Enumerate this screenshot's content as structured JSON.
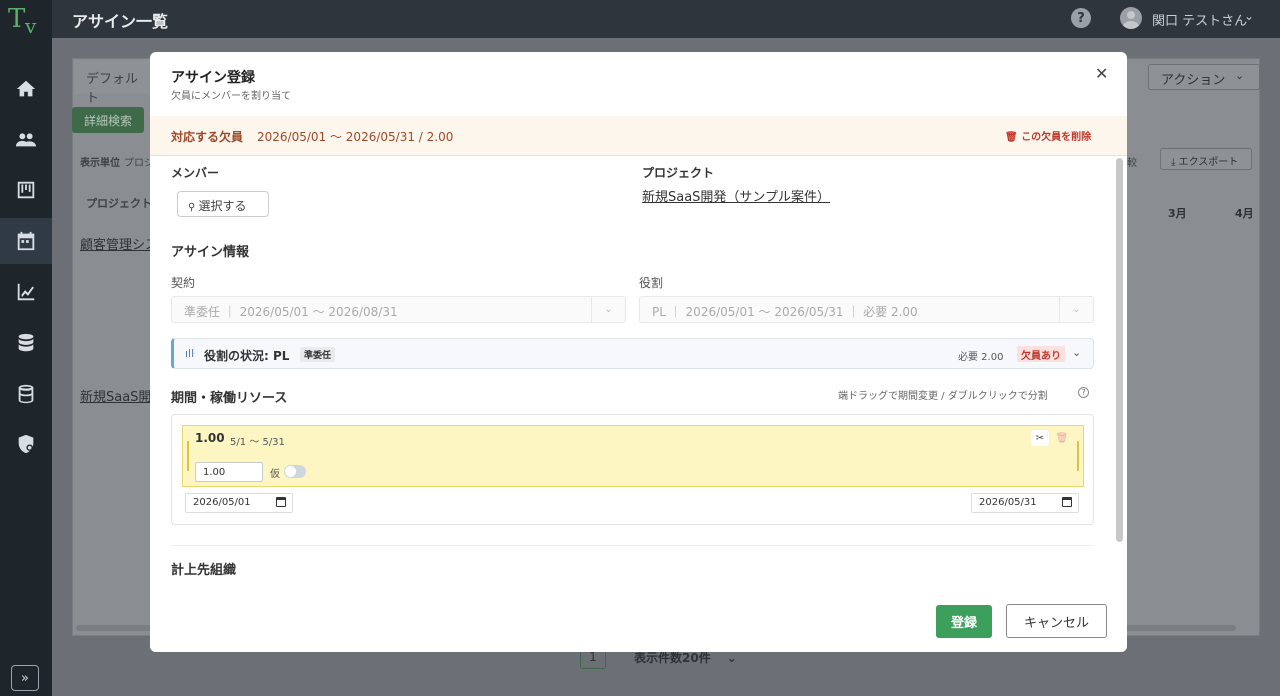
{
  "app": {
    "logo_t": "T",
    "logo_v": "v",
    "page_title": "アサイン一覧",
    "help": "?",
    "user_name": "関口 テストさん",
    "expand": "»"
  },
  "background": {
    "tab_default": "デフォルト",
    "detail_search": "詳細検索",
    "unit_label": "表示単位",
    "unit_value": "プロジ",
    "project_col": "プロジェクト",
    "row1_link": "顧客管理シス",
    "row2_link": "新規SaaS開",
    "action": "アクション",
    "compare": "較",
    "export": "エクスポート",
    "month_mar": "3月",
    "month_apr": "4月",
    "page_num": "1",
    "page_size": "表示件数20件"
  },
  "modal": {
    "title": "アサイン登録",
    "subtitle": "欠員にメンバーを割り当て",
    "vacancy_label": "対応する欠員",
    "vacancy_value": "2026/05/01 〜 2026/05/31 / 2.00",
    "vacancy_delete": "この欠員を削除",
    "member_label": "メンバー",
    "select_button": "選択する",
    "project_label": "プロジェクト",
    "project_link": "新規SaaS開発（サンプル案件）",
    "assign_info_title": "アサイン情報",
    "contract_label": "契約",
    "contract_value": "準委任 ｜ 2026/05/01 〜 2026/08/31",
    "role_label": "役割",
    "role_value": "PL ｜ 2026/05/01 〜 2026/05/31 ｜ 必要 2.00",
    "role_status": {
      "text": "役割の状況: PL",
      "tag": "準委任",
      "required": "必要 2.00",
      "badge": "欠員あり"
    },
    "period_title": "期間・稼働リソース",
    "period_hint": "端ドラッグで期間変更 / ダブルクリックで分割",
    "period": {
      "value": "1.00",
      "range": "5/1 〜 5/31",
      "input_value": "1.00",
      "tentative_label": "仮",
      "start_date": "2026/05/01",
      "end_date": "2026/05/31"
    },
    "org_title": "計上先組織",
    "register": "登録",
    "cancel": "キャンセル"
  }
}
